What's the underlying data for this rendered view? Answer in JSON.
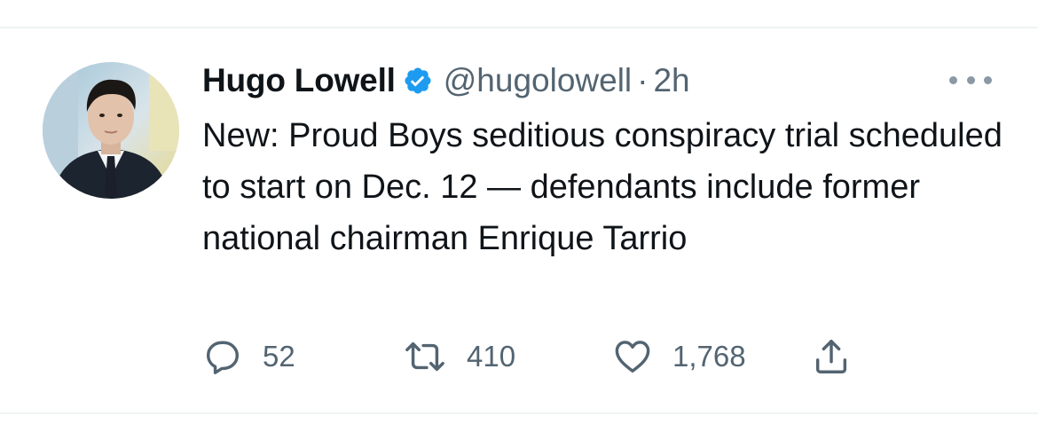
{
  "tweet": {
    "author": {
      "name": "Hugo Lowell",
      "handle": "@hugolowell",
      "verified": true,
      "separator": "·",
      "time": "2h"
    },
    "text": "New: Proud Boys seditious conspiracy trial scheduled to start on Dec. 12 — defendants include former national chairman Enrique Tarrio",
    "actions": {
      "reply": {
        "icon": "reply-icon",
        "count": "52"
      },
      "retweet": {
        "icon": "retweet-icon",
        "count": "410"
      },
      "like": {
        "icon": "heart-icon",
        "count": "1,768"
      },
      "share": {
        "icon": "share-icon"
      }
    },
    "more_icon": "more-options-icon"
  },
  "colors": {
    "text_primary": "#0f1419",
    "text_secondary": "#536471",
    "verified_blue": "#1d9bf0",
    "divider": "#eff3f4"
  }
}
